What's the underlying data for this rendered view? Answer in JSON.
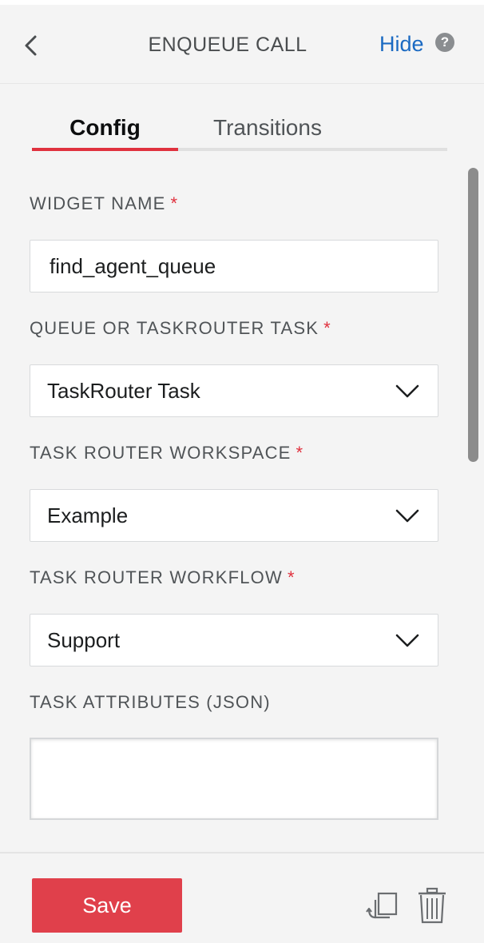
{
  "header": {
    "title": "ENQUEUE CALL",
    "hide_label": "Hide",
    "help_glyph": "?",
    "back_icon": "chevron-left-icon"
  },
  "tabs": [
    {
      "label": "Config",
      "active": true
    },
    {
      "label": "Transitions",
      "active": false
    }
  ],
  "form": {
    "widget_name": {
      "label": "WIDGET NAME",
      "required_mark": "*",
      "value": "find_agent_queue"
    },
    "queue_or_task": {
      "label": "QUEUE OR TASKROUTER TASK",
      "required_mark": "*",
      "selected": "TaskRouter Task"
    },
    "workspace": {
      "label": "TASK ROUTER WORKSPACE",
      "required_mark": "*",
      "selected": "Example"
    },
    "workflow": {
      "label": "TASK ROUTER WORKFLOW",
      "required_mark": "*",
      "selected": "Support"
    },
    "task_attributes": {
      "label": "TASK ATTRIBUTES (JSON)",
      "value": ""
    }
  },
  "footer": {
    "save_label": "Save",
    "copy_icon": "duplicate-icon",
    "delete_icon": "trash-icon"
  },
  "colors": {
    "accent_red": "#e0313e",
    "save_button": "#e0404b",
    "link_blue": "#1b6ac2",
    "background": "#f4f4f4"
  }
}
